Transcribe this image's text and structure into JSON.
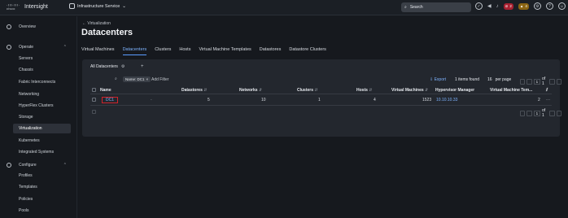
{
  "topbar": {
    "cisco_label": "cisco",
    "brand": "Intersight",
    "service": "Infrastructure Service",
    "search_placeholder": "Search",
    "alerts_red": "2",
    "alerts_amber": "4"
  },
  "sidebar": {
    "overview": "Overview",
    "operate": "Operate",
    "operate_items": [
      "Servers",
      "Chassis",
      "Fabric Interconnects",
      "Networking",
      "HyperFlex Clusters",
      "Storage",
      "Virtualization",
      "Kubernetes",
      "Integrated Systems"
    ],
    "configure": "Configure",
    "configure_items": [
      "Profiles",
      "Templates",
      "Policies",
      "Pools"
    ]
  },
  "main": {
    "breadcrumb": "← Virtualization",
    "title": "Datacenters",
    "tabs": [
      "Virtual Machines",
      "Datacenters",
      "Clusters",
      "Hosts",
      "Virtual Machine Templates",
      "Datastores",
      "Datastore Clusters"
    ],
    "active_tab": "Datacenters"
  },
  "table": {
    "view_label": "All Datacenters",
    "chip_label": "Name: DC1",
    "add_filter": "Add Filter",
    "export": "Export",
    "items_found": "1 items found",
    "per_page_value": "16",
    "per_page_label": "per page",
    "page_current": "1",
    "page_of": "of 1",
    "headers": [
      "Name",
      "Datastores",
      "Networks",
      "Clusters",
      "Hosts",
      "Virtual Machines",
      "Hypervisor Manager",
      "Virtual Machine Tem..."
    ],
    "row": {
      "name": "DC1",
      "datastores": "5",
      "networks": "10",
      "clusters": "1",
      "hosts": "4",
      "virtual_machines": "1523",
      "hypervisor_manager": "10.10.10.33",
      "vm_templates": "2"
    },
    "footer_page": "1",
    "footer_of": "of 1"
  }
}
